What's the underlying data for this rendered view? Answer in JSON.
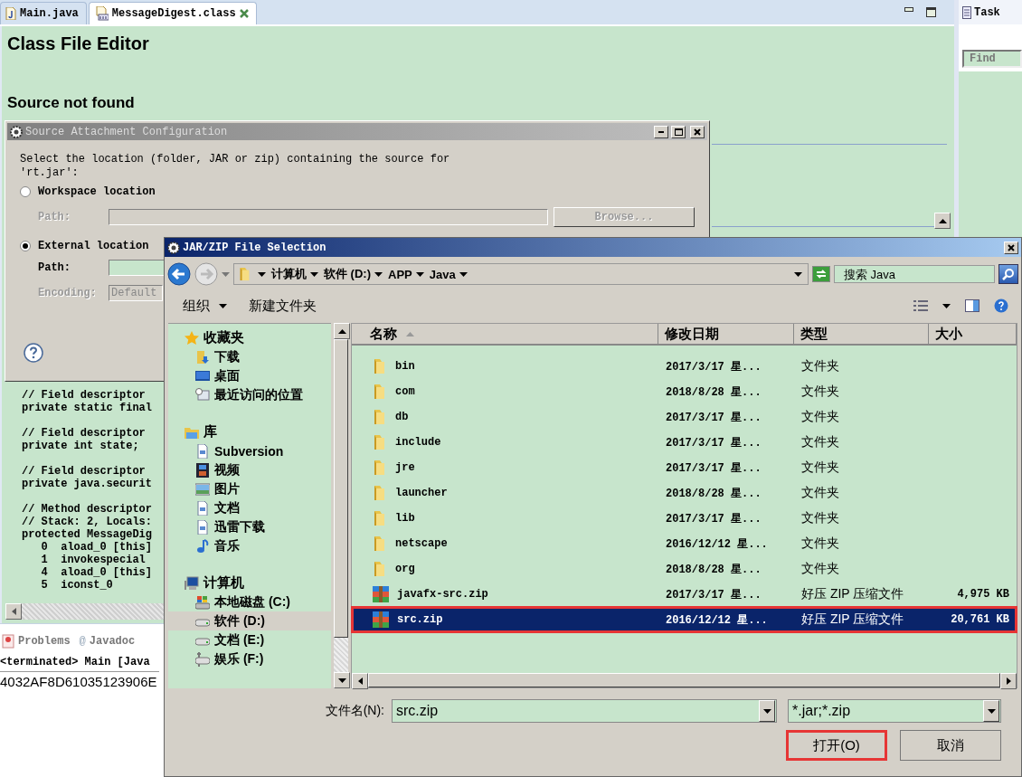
{
  "editor": {
    "tabs": [
      {
        "label": "Main.java",
        "kind": "java",
        "selected": false
      },
      {
        "label": "MessageDigest.class",
        "kind": "class",
        "selected": true
      }
    ],
    "title": "Class File Editor",
    "subtitle": "Source not found",
    "code_blocks": [
      [
        "// Field descriptor",
        "private static final"
      ],
      [
        "// Field descriptor",
        "private int state;"
      ],
      [
        "// Field descriptor",
        "private java.securit"
      ],
      [
        "// Method descriptor",
        "// Stack: 2, Locals:",
        "protected MessageDig",
        "   0  aload_0 [this]",
        "   1  invokespecial",
        "   4  aload_0 [this]",
        "   5  iconst_0"
      ]
    ]
  },
  "side_panel": {
    "tab": "Task",
    "find_placeholder": "Find"
  },
  "bottom_panel": {
    "tabs": [
      {
        "label": "Problems",
        "kind": "problems"
      },
      {
        "label": "Javadoc",
        "kind": "javadoc",
        "icon": "@"
      }
    ],
    "console_title": "<terminated> Main [Java",
    "output": "4032AF8D61035123906E"
  },
  "source_dialog": {
    "title": "Source Attachment Configuration",
    "description": "Select the location (folder, JAR or zip) containing the source for 'rt.jar':",
    "options": [
      {
        "label": "Workspace location",
        "selected": false,
        "path_label": "Path:",
        "disabled": true,
        "browse": "Browse..."
      },
      {
        "label": "External location",
        "selected": true,
        "path_label": "Path:",
        "disabled": false
      }
    ],
    "encoding": {
      "label": "Encoding:",
      "value": "Default",
      "disabled": true
    }
  },
  "file_dialog": {
    "title": "JAR/ZIP File Selection",
    "breadcrumb": [
      "计算机",
      "软件 (D:)",
      "APP",
      "Java"
    ],
    "search": {
      "placeholder": "搜索 Java"
    },
    "toolbar": [
      {
        "label": "组织",
        "dropdown": true
      },
      {
        "label": "新建文件夹",
        "dropdown": false
      }
    ],
    "nav": [
      {
        "label": "收藏夹",
        "kind": "favorites",
        "selected": false,
        "children": [
          {
            "label": "下载",
            "kind": "downloads",
            "selected": false
          },
          {
            "label": "桌面",
            "kind": "desktop",
            "selected": false
          },
          {
            "label": "最近访问的位置",
            "kind": "recent",
            "selected": false
          }
        ]
      },
      {
        "label": "库",
        "kind": "library",
        "selected": false,
        "children": [
          {
            "label": "Subversion",
            "kind": "document",
            "selected": false
          },
          {
            "label": "视频",
            "kind": "video",
            "selected": false
          },
          {
            "label": "图片",
            "kind": "picture",
            "selected": false
          },
          {
            "label": "文档",
            "kind": "document",
            "selected": false
          },
          {
            "label": "迅雷下载",
            "kind": "document",
            "selected": false
          },
          {
            "label": "音乐",
            "kind": "music",
            "selected": false
          }
        ]
      },
      {
        "label": "计算机",
        "kind": "computer",
        "selected": false,
        "children": [
          {
            "label": "本地磁盘 (C:)",
            "kind": "system-drive",
            "selected": false
          },
          {
            "label": "软件 (D:)",
            "kind": "drive",
            "selected": true
          },
          {
            "label": "文档 (E:)",
            "kind": "drive",
            "selected": false
          },
          {
            "label": "娱乐 (F:)",
            "kind": "network-drive",
            "selected": false
          }
        ]
      }
    ],
    "columns": [
      {
        "label": "名称",
        "sorted": true
      },
      {
        "label": "修改日期",
        "sorted": false
      },
      {
        "label": "类型",
        "sorted": false
      },
      {
        "label": "大小",
        "sorted": false
      }
    ],
    "files": [
      {
        "name": "bin",
        "date": "2017/3/17 星...",
        "type": "文件夹",
        "kind": "folder",
        "selected": false
      },
      {
        "name": "com",
        "date": "2018/8/28 星...",
        "type": "文件夹",
        "kind": "folder",
        "selected": false
      },
      {
        "name": "db",
        "date": "2017/3/17 星...",
        "type": "文件夹",
        "kind": "folder",
        "selected": false
      },
      {
        "name": "include",
        "date": "2017/3/17 星...",
        "type": "文件夹",
        "kind": "folder",
        "selected": false
      },
      {
        "name": "jre",
        "date": "2017/3/17 星...",
        "type": "文件夹",
        "kind": "folder",
        "selected": false
      },
      {
        "name": "launcher",
        "date": "2018/8/28 星...",
        "type": "文件夹",
        "kind": "folder",
        "selected": false
      },
      {
        "name": "lib",
        "date": "2017/3/17 星...",
        "type": "文件夹",
        "kind": "folder",
        "selected": false
      },
      {
        "name": "netscape",
        "date": "2016/12/12 星...",
        "type": "文件夹",
        "kind": "folder",
        "selected": false
      },
      {
        "name": "org",
        "date": "2018/8/28 星...",
        "type": "文件夹",
        "kind": "folder",
        "selected": false
      },
      {
        "name": "javafx-src.zip",
        "date": "2017/3/17 星...",
        "type": "好压 ZIP 压缩文件",
        "size": "4,975 KB",
        "kind": "zip",
        "selected": false
      },
      {
        "name": "src.zip",
        "date": "2016/12/12 星...",
        "type": "好压 ZIP 压缩文件",
        "size": "20,761 KB",
        "kind": "zip",
        "selected": true
      }
    ],
    "file_name": {
      "label": "文件名(N):",
      "value": "src.zip"
    },
    "filter": {
      "value": "*.jar;*.zip"
    },
    "buttons": [
      {
        "label": "打开(O)",
        "highlighted": true
      },
      {
        "label": "取消",
        "highlighted": false
      }
    ]
  }
}
